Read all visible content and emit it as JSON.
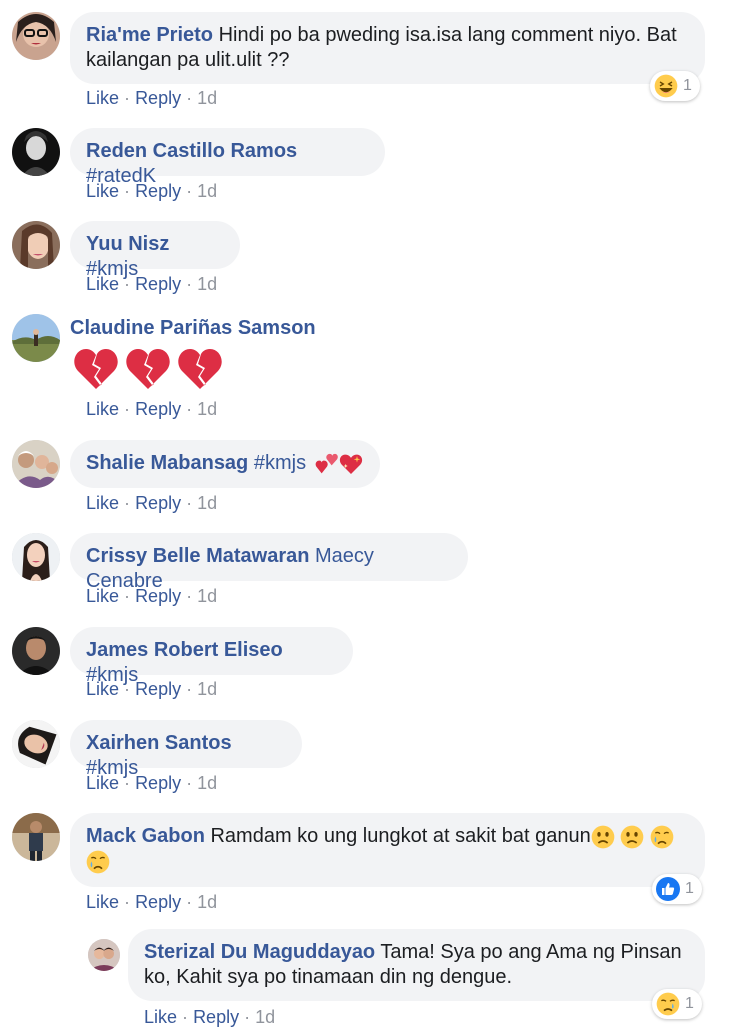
{
  "actions": {
    "like": "Like",
    "reply": "Reply",
    "separator": "·"
  },
  "comments": [
    {
      "author": "Ria'me Prieto",
      "text": "Hindi po ba pweding isa.isa lang comment niyo. Bat kailangan pa ulit.ulit ??",
      "time": "1d",
      "reaction": {
        "icon": "laughing-face-icon",
        "count": "1"
      }
    },
    {
      "author": "Reden Castillo Ramos",
      "tag": "#ratedK",
      "time": "1d"
    },
    {
      "author": "Yuu Nisz",
      "tag": "#kmjs",
      "time": "1d"
    },
    {
      "author": "Claudine Pariñas Samson",
      "emoji": "broken-heart-icon x3",
      "time": "1d"
    },
    {
      "author": "Shalie Mabansag",
      "tag": "#kmjs",
      "emoji": "two-hearts-icon, sparkling-heart-icon",
      "time": "1d"
    },
    {
      "author": "Crissy Belle Matawaran",
      "tag": "Maecy Cenabre",
      "time": "1d"
    },
    {
      "author": "James Robert Eliseo",
      "tag": "#kmjs",
      "time": "1d"
    },
    {
      "author": "Xairhen Santos",
      "tag": "#kmjs",
      "time": "1d"
    },
    {
      "author": "Mack Gabon",
      "text": "Ramdam ko ung lungkot at sakit bat ganun",
      "emoji": "frowning-face-icon x2, crying-face-icon x2",
      "time": "1d",
      "reaction": {
        "icon": "thumbs-up-icon",
        "count": "1"
      }
    },
    {
      "author": "Sterizal Du Maguddayao",
      "text": "Tama! Sya po ang Ama ng Pinsan ko, Kahit sya po tinamaan din ng dengue.",
      "time": "1d",
      "reaction": {
        "icon": "sad-face-icon",
        "count": "1"
      }
    }
  ],
  "colors": {
    "link": "#385898",
    "bubble": "#f2f3f5",
    "meta": "#90949c",
    "like_blue": "#1877f2"
  }
}
